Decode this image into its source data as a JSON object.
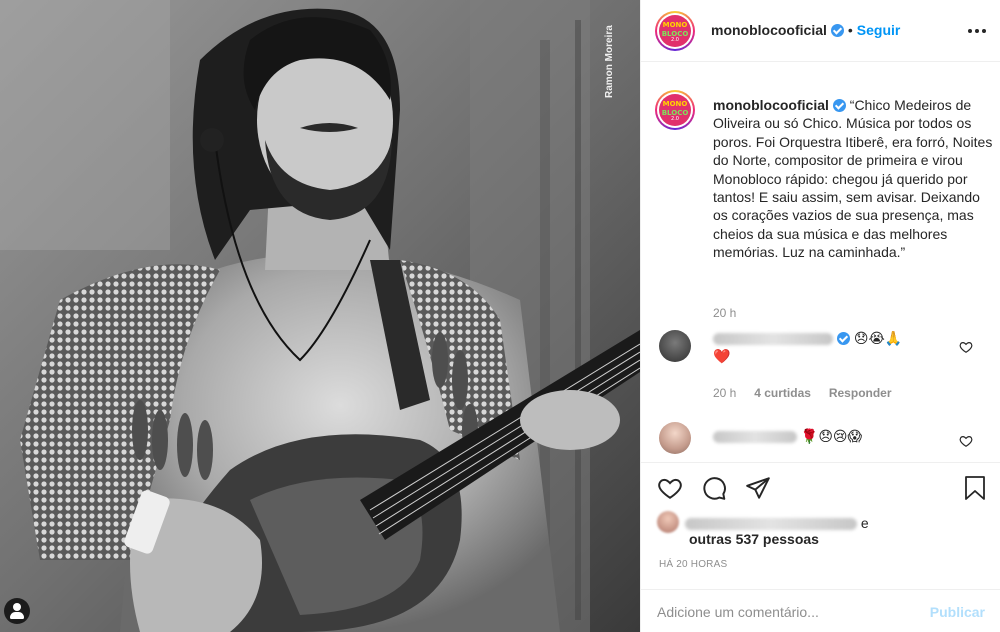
{
  "post": {
    "photo_credit": "Ramon Moreira",
    "photo_alt_icon": "user-tag-icon"
  },
  "header": {
    "username": "monoblocooficial",
    "separator": "•",
    "follow_label": "Seguir",
    "avatar_logo_top": "MONO",
    "avatar_logo_bottom": "BLOCO",
    "avatar_logo_num": "2.0"
  },
  "caption": {
    "username": "monoblocooficial",
    "text": "“Chico Medeiros de Oliveira ou só Chico. Música por todos os poros. Foi Orquestra Itiberê, era forró, Noites do Norte, compositor de primeira e virou Monobloco rápido: chegou já querido por tantos! E saiu assim, sem avisar. Deixando os corações vazios de sua presença, mas cheios da sua música e das melhores memórias. Luz na caminhada.”",
    "time": "20 h"
  },
  "comments": [
    {
      "emojis": "😞😭🙏",
      "second_line": "❤️",
      "time": "20 h",
      "likes": "4 curtidas",
      "reply": "Responder"
    },
    {
      "emojis": "🌹😞😢😱"
    }
  ],
  "likes": {
    "and_word": "e",
    "others": "outras 537 pessoas"
  },
  "posted_ago": "HÁ 20 HORAS",
  "add_comment": {
    "placeholder": "Adicione um comentário...",
    "publish": "Publicar"
  },
  "colors": {
    "accent": "#0095f6",
    "verified": "#3897f0",
    "heart": "#ed4956",
    "publish_disabled": "#b2dffc",
    "muted": "#8e8e8e"
  }
}
